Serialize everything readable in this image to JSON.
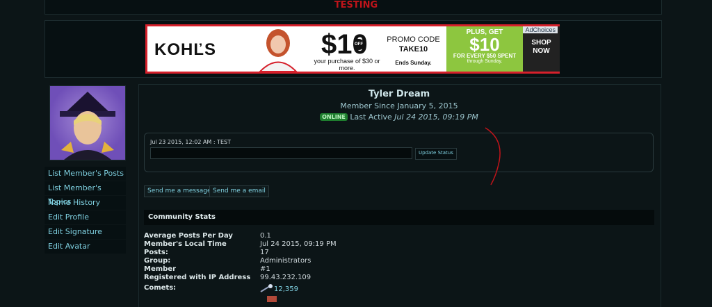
{
  "site": {
    "title": "TESTING"
  },
  "ad": {
    "brand": "KOHĽS",
    "amount": "$10",
    "off": "OFF",
    "purchase": "your purchase of $30 or more.",
    "promo_label": "PROMO CODE",
    "promo_code": "TAKE10",
    "ends": "Ends Sunday.",
    "plus": "PLUS, GET",
    "bonus": "$10",
    "bonus_detail": "FOR EVERY $50 SPENT",
    "bonus_through": "through Sunday.",
    "shop": "SHOP NOW",
    "adchoices": "AdChoices"
  },
  "sidebar": {
    "items": [
      {
        "label": "List Member's Posts"
      },
      {
        "label": "List Member's Topics"
      },
      {
        "label": "Name History"
      },
      {
        "label": "Edit Profile"
      },
      {
        "label": "Edit Signature"
      },
      {
        "label": "Edit Avatar"
      }
    ]
  },
  "profile": {
    "name": "Tyler Dream",
    "since": "Member Since January 5, 2015",
    "online_badge": "ONLINE",
    "last_active_label": "Last Active",
    "last_active_value": "Jul 24 2015, 09:19 PM"
  },
  "status": {
    "text": "Jul 23 2015, 12:02 AM : TEST",
    "input_value": "",
    "update_label": "Update Status"
  },
  "actions": {
    "message": "Send me a message",
    "email": "Send me a email"
  },
  "stats": {
    "heading": "Community Stats",
    "rows": [
      {
        "label": "Average Posts Per Day",
        "value": "0.1"
      },
      {
        "label": "Member's Local Time",
        "value": "Jul 24 2015, 09:19 PM"
      },
      {
        "label": "Posts:",
        "value": "17"
      },
      {
        "label": "Group:",
        "value": "Administrators"
      },
      {
        "label": "Member",
        "value": "#1"
      },
      {
        "label": "Registered with IP Address",
        "value": "99.43.232.109"
      },
      {
        "label": "Comets:",
        "value": "12,359"
      }
    ]
  },
  "colors": {
    "accent": "#7fd0e0",
    "title_red": "#c0141a",
    "online_green": "#1e7d2e"
  }
}
